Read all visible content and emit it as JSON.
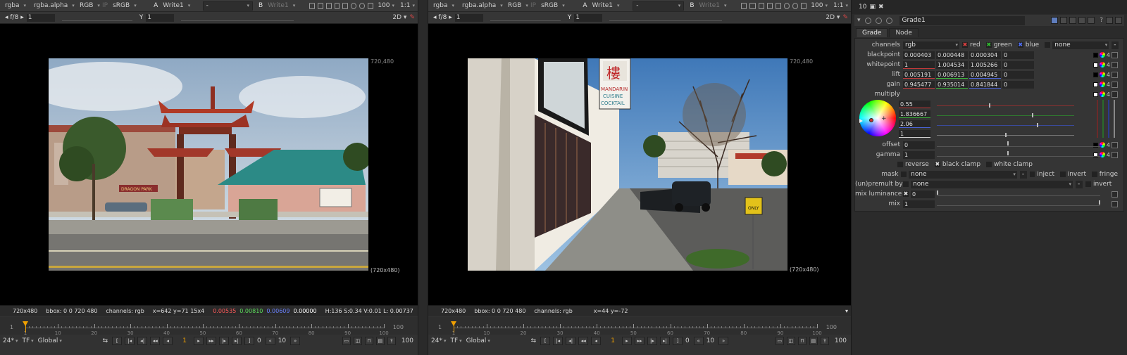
{
  "viewer_left": {
    "toolbar": {
      "channel_layer": "rgba",
      "alpha_channel": "rgba.alpha",
      "display_channels": "RGB",
      "ip_label": "IP",
      "colorspace": "sRGB",
      "input_a_label": "A",
      "input_a": "Write1",
      "wipe_mode": "-",
      "input_b_label": "B",
      "input_b": "Write1",
      "zoom_percent": "100",
      "proxy_ratio": "1:1"
    },
    "toolbar2": {
      "gain_label": "f/8",
      "gain_value": "1",
      "gamma_label": "Y",
      "gamma_value": "1",
      "view_mode": "2D"
    },
    "format_label_top": "720,480",
    "format_label_bottom": "(720x480)",
    "status": {
      "format": "720x480",
      "bbox": "bbox: 0 0 720 480",
      "channels": "channels: rgb",
      "position": "x=642 y=71 15x4",
      "r": "0.00535",
      "g": "0.00810",
      "b": "0.00609",
      "a": "0.00000",
      "hsvl": "H:136 S:0.34 V:0.01  L: 0.00737"
    },
    "timeline": {
      "start": "1",
      "end": "100",
      "labels": [
        "1",
        "10",
        "20",
        "30",
        "40",
        "50",
        "60",
        "70",
        "80",
        "90",
        "100"
      ],
      "current_frame": 1
    },
    "controls": {
      "fps": "24*",
      "tf": "TF",
      "scope": "Global",
      "current_frame": "1",
      "in_point": "0",
      "step": "10",
      "end_frame": "100"
    }
  },
  "viewer_right": {
    "toolbar": {
      "channel_layer": "rgba",
      "alpha_channel": "rgba.alpha",
      "display_channels": "RGB",
      "ip_label": "IP",
      "colorspace": "sRGB",
      "input_a_label": "A",
      "input_a": "Write1",
      "wipe_mode": "-",
      "input_b_label": "B",
      "input_b": "Write1",
      "zoom_percent": "100",
      "proxy_ratio": "1:1"
    },
    "toolbar2": {
      "gain_label": "f/8",
      "gain_value": "1",
      "gamma_label": "Y",
      "gamma_value": "1",
      "view_mode": "2D"
    },
    "format_label_top": "720,480",
    "format_label_bottom": "(720x480)",
    "status": {
      "format": "720x480",
      "bbox": "bbox: 0 0 720 480",
      "channels": "channels: rgb",
      "position": "x=44 y=-72"
    },
    "timeline": {
      "start": "1",
      "end": "100",
      "labels": [
        "1",
        "10",
        "20",
        "30",
        "40",
        "50",
        "60",
        "70",
        "80",
        "90",
        "100"
      ],
      "current_frame": 1
    },
    "controls": {
      "fps": "24*",
      "tf": "TF",
      "scope": "Global",
      "current_frame": "1",
      "in_point": "0",
      "step": "10",
      "end_frame": "100"
    }
  },
  "properties": {
    "max_panels": "10",
    "node_name": "Grade1",
    "tabs": [
      "Grade",
      "Node"
    ],
    "channels": {
      "label": "channels",
      "value": "rgb",
      "red": "red",
      "green": "green",
      "blue": "blue",
      "extra": "none"
    },
    "blackpoint": {
      "label": "blackpoint",
      "values": [
        "0.000403",
        "0.000448",
        "0.000304",
        "0"
      ]
    },
    "whitepoint": {
      "label": "whitepoint",
      "values": [
        "1",
        "1.004534",
        "1.005266",
        "0"
      ]
    },
    "lift": {
      "label": "lift",
      "values": [
        "0.005191",
        "0.006913",
        "0.004945",
        "0"
      ]
    },
    "gain": {
      "label": "gain",
      "values": [
        "0.945477",
        "0.935014",
        "0.841844",
        "0"
      ]
    },
    "multiply": {
      "label": "multiply",
      "values": [
        "0.55",
        "1.836667",
        "2.06",
        "1"
      ]
    },
    "offset": {
      "label": "offset",
      "value": "0"
    },
    "gamma": {
      "label": "gamma",
      "value": "1"
    },
    "reverse_label": "reverse",
    "black_clamp_label": "black clamp",
    "white_clamp_label": "white clamp",
    "mask": {
      "label": "mask",
      "value": "none",
      "inject": "inject",
      "invert": "invert",
      "fringe": "fringe"
    },
    "unpremult": {
      "label": "(un)premult by",
      "value": "none",
      "invert": "invert"
    },
    "mix_luminance": {
      "label": "mix luminance",
      "value": "0"
    },
    "mix": {
      "label": "mix",
      "value": "1"
    },
    "four_label": "4"
  },
  "left_image_sign": "DRAGON PARK",
  "right_image_sign": {
    "line1": "MANDARIN",
    "line2": "CUISINE",
    "line3": "COCKTAIL",
    "parking": "ONLY"
  }
}
